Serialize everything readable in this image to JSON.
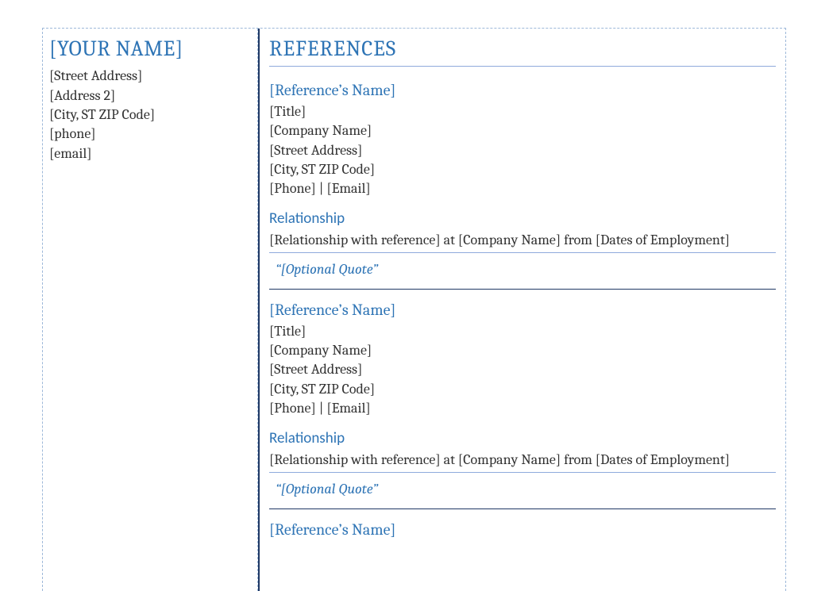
{
  "sidebar": {
    "name": "[YOUR NAME]",
    "street": "[Street Address]",
    "address2": "[Address 2]",
    "citystzip": "[City, ST  ZIP Code]",
    "phone": "[phone]",
    "email": "[email]"
  },
  "main": {
    "title": "REFERENCES",
    "references": [
      {
        "name": "[Reference’s Name]",
        "title": "[Title]",
        "company": "[Company Name]",
        "street": "[Street Address]",
        "citystzip": "[City, ST  ZIP Code]",
        "phone_email": "[Phone] | [Email]",
        "rel_heading": "Relationship",
        "rel_text": "[Relationship with reference] at [Company Name] from [Dates of Employment]",
        "quote": "“[Optional Quote”"
      },
      {
        "name": "[Reference’s Name]",
        "title": "[Title]",
        "company": "[Company Name]",
        "street": "[Street Address]",
        "citystzip": "[City, ST  ZIP Code]",
        "phone_email": "[Phone] | [Email]",
        "rel_heading": "Relationship",
        "rel_text": "[Relationship with reference] at [Company Name] from [Dates of Employment]",
        "quote": "“[Optional Quote”"
      },
      {
        "name": "[Reference’s Name]"
      }
    ]
  }
}
